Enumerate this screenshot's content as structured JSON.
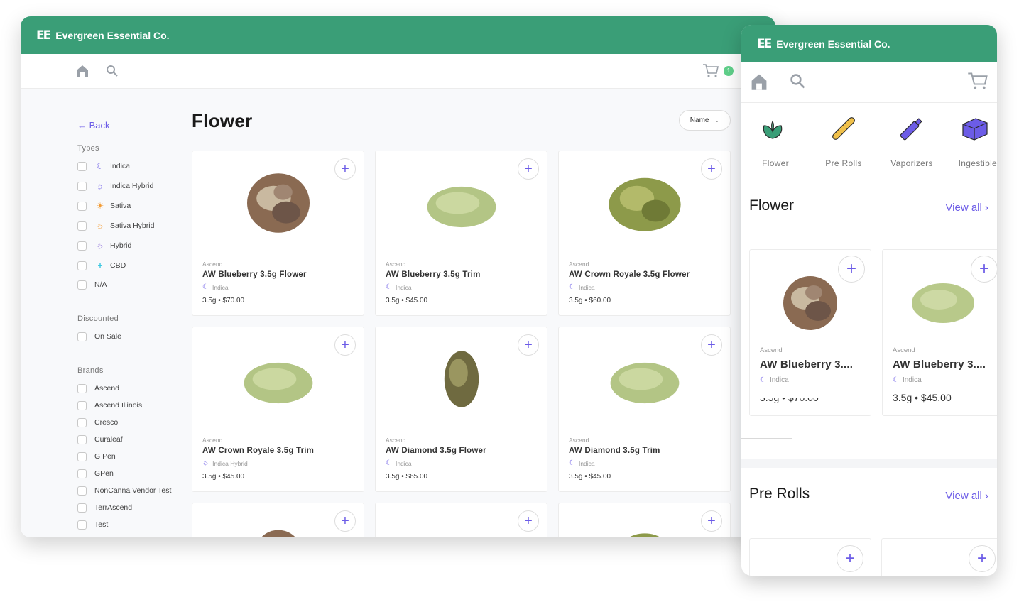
{
  "app": {
    "name": "Evergreen Essential Co.",
    "logo": "EE"
  },
  "desktop": {
    "cart_count": "1",
    "back_label": "← Back",
    "page_title": "Flower",
    "sort_label": "Name",
    "filters": {
      "types_label": "Types",
      "types": [
        {
          "label": "Indica",
          "icon": "moon-icon"
        },
        {
          "label": "Indica Hybrid",
          "icon": "indica-hybrid-icon"
        },
        {
          "label": "Sativa",
          "icon": "sun-icon"
        },
        {
          "label": "Sativa Hybrid",
          "icon": "sativa-hybrid-icon"
        },
        {
          "label": "Hybrid",
          "icon": "hybrid-icon"
        },
        {
          "label": "CBD",
          "icon": "plus-icon"
        },
        {
          "label": "N/A",
          "icon": ""
        }
      ],
      "discounted_label": "Discounted",
      "discounted": [
        {
          "label": "On Sale"
        }
      ],
      "brands_label": "Brands",
      "brands": [
        {
          "label": "Ascend"
        },
        {
          "label": "Ascend Illinois"
        },
        {
          "label": "Cresco"
        },
        {
          "label": "Curaleaf"
        },
        {
          "label": "G Pen"
        },
        {
          "label": "GPen"
        },
        {
          "label": "NonCanna Vendor Test"
        },
        {
          "label": "TerrAscend"
        },
        {
          "label": "Test"
        }
      ]
    },
    "products": [
      {
        "brand": "Ascend",
        "name": "AW Blueberry 3.5g Flower",
        "strain": "Indica",
        "price": "3.5g • $70.00",
        "img": "bud-purple"
      },
      {
        "brand": "Ascend",
        "name": "AW Blueberry 3.5g Trim",
        "strain": "Indica",
        "price": "3.5g • $45.00",
        "img": "trim"
      },
      {
        "brand": "Ascend",
        "name": "AW Crown Royale 3.5g Flower",
        "strain": "Indica",
        "price": "3.5g • $60.00",
        "img": "bud-green"
      },
      {
        "brand": "Ascend",
        "name": "AW Crown Royale 3.5g Trim",
        "strain": "Indica Hybrid",
        "price": "3.5g • $45.00",
        "img": "trim"
      },
      {
        "brand": "Ascend",
        "name": "AW Diamond 3.5g Flower",
        "strain": "Indica",
        "price": "3.5g • $65.00",
        "img": "bud-small"
      },
      {
        "brand": "Ascend",
        "name": "AW Diamond 3.5g Trim",
        "strain": "Indica",
        "price": "3.5g • $45.00",
        "img": "trim"
      }
    ]
  },
  "mobile": {
    "categories": [
      {
        "label": "Flower",
        "icon": "leaf-icon"
      },
      {
        "label": "Pre Rolls",
        "icon": "pre-roll-icon"
      },
      {
        "label": "Vaporizers",
        "icon": "vaporizer-icon"
      },
      {
        "label": "Ingestibles",
        "icon": "ingestible-icon"
      }
    ],
    "sections": [
      {
        "title": "Flower",
        "view_all": "View all ›"
      },
      {
        "title": "Pre Rolls",
        "view_all": "View all ›"
      }
    ],
    "cards": [
      {
        "brand": "Ascend",
        "name": "AW Blueberry 3....",
        "strain": "Indica",
        "price": "3.5g • $70.00"
      },
      {
        "brand": "Ascend",
        "name": "AW Blueberry 3....",
        "strain": "Indica",
        "price": "3.5g • $45.00"
      }
    ]
  },
  "colors": {
    "brand_green": "#3a9e77",
    "accent_purple": "#6c5ce7",
    "badge_green": "#5fd08a"
  }
}
